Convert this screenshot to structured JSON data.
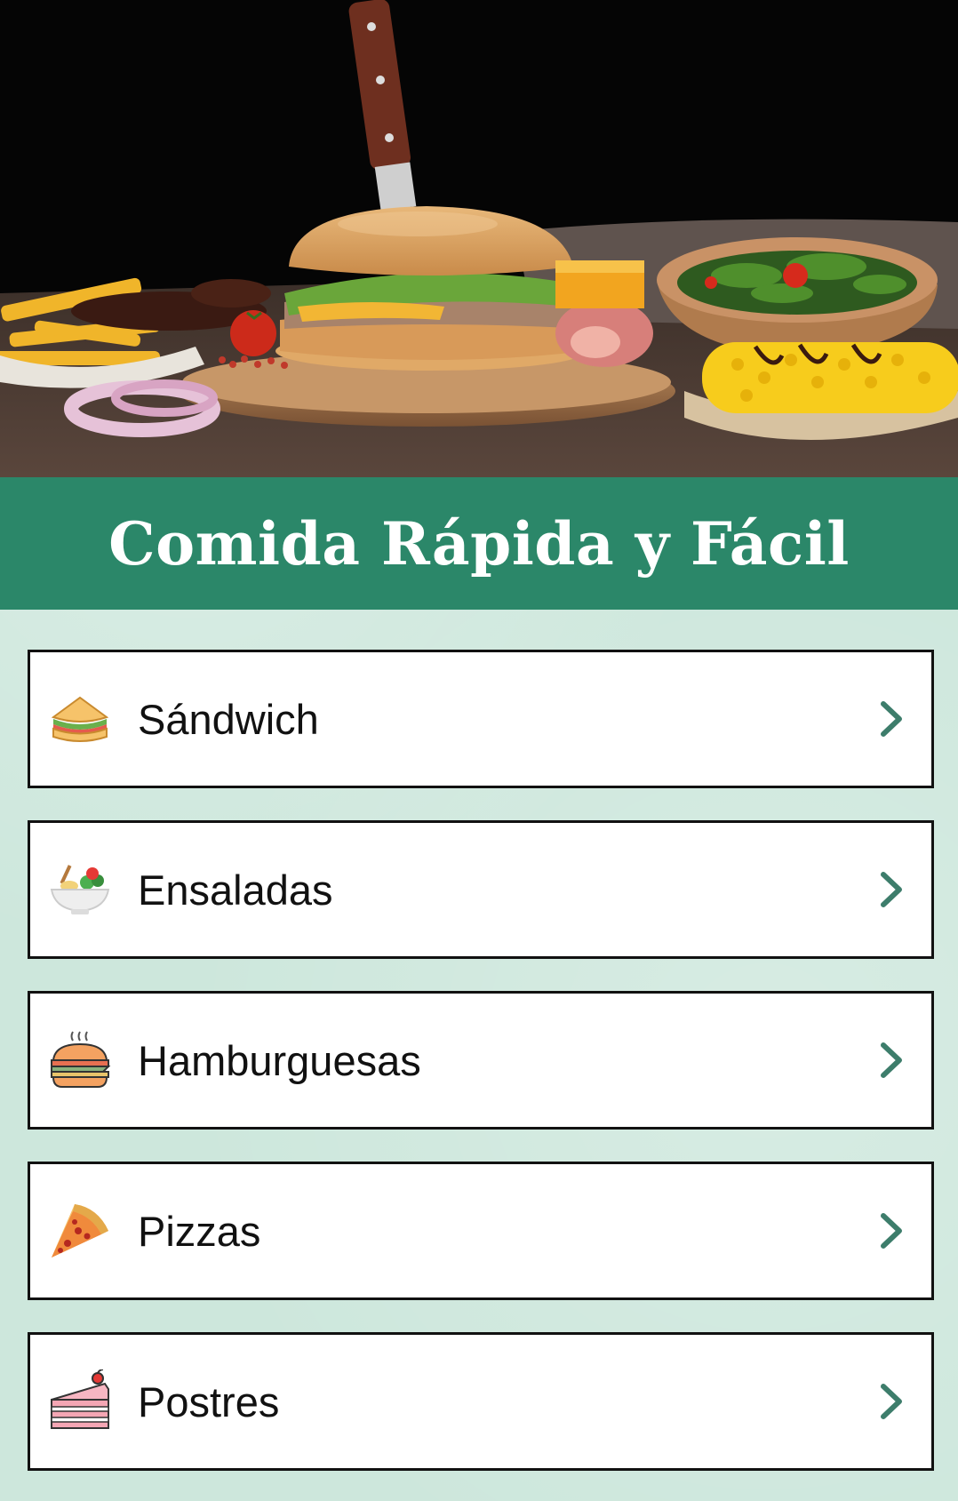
{
  "header": {
    "title": "Comida Rápida y Fácil",
    "hero_image": "fast-food-burger-photo"
  },
  "colors": {
    "title_bar": "#2b8769",
    "background": "#cde7dc",
    "chevron": "#3d7d6b",
    "card_border": "#111111"
  },
  "categories": [
    {
      "label": "Sándwich",
      "icon": "sandwich-icon"
    },
    {
      "label": "Ensaladas",
      "icon": "salad-bowl-icon"
    },
    {
      "label": "Hamburguesas",
      "icon": "hamburger-icon"
    },
    {
      "label": "Pizzas",
      "icon": "pizza-slice-icon"
    },
    {
      "label": "Postres",
      "icon": "cake-slice-icon"
    }
  ],
  "chevron_icon": "chevron-right-icon"
}
